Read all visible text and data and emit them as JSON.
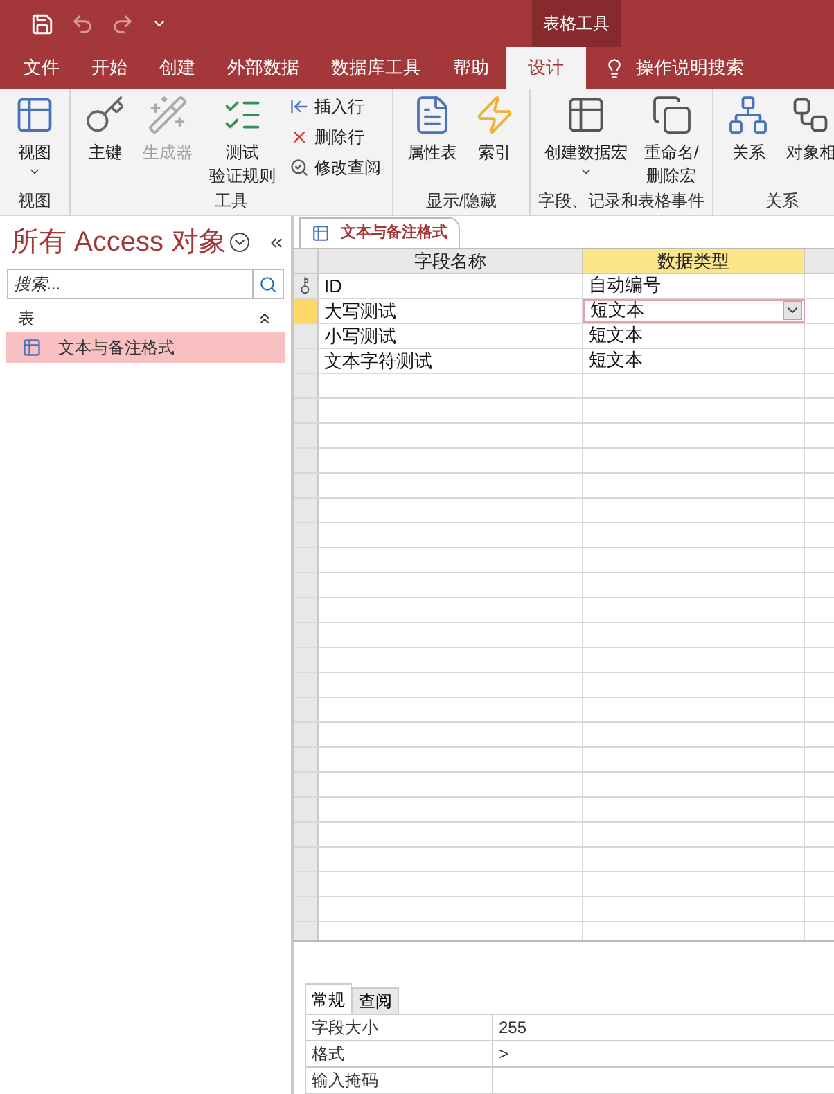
{
  "title_bar": {
    "contextual_label": "表格工具",
    "quick_access": [
      {
        "kind": "save",
        "disabled": false
      },
      {
        "kind": "undo",
        "disabled": true
      },
      {
        "kind": "redo",
        "disabled": true
      },
      {
        "kind": "customize",
        "disabled": false
      }
    ]
  },
  "ribbon_tabs": [
    {
      "label": "文件",
      "selected": false
    },
    {
      "label": "开始",
      "selected": false
    },
    {
      "label": "创建",
      "selected": false
    },
    {
      "label": "外部数据",
      "selected": false
    },
    {
      "label": "数据库工具",
      "selected": false
    },
    {
      "label": "帮助",
      "selected": false
    },
    {
      "label": "设计",
      "selected": true
    }
  ],
  "tell_me": "操作说明搜索",
  "ribbon_groups": [
    {
      "label": "视图",
      "items": [
        {
          "kind": "large",
          "label_lines": [
            "视图"
          ],
          "dropdown": true,
          "disabled": false
        }
      ]
    },
    {
      "label": "工具",
      "items": [
        {
          "kind": "large",
          "label_lines": [
            "主键"
          ],
          "dropdown": false,
          "disabled": false
        },
        {
          "kind": "large",
          "label_lines": [
            "生成器"
          ],
          "dropdown": false,
          "disabled": true
        },
        {
          "kind": "large",
          "label_lines": [
            "测试",
            "验证规则"
          ],
          "dropdown": false,
          "disabled": false
        },
        {
          "kind": "small",
          "label_lines": [
            "插入行"
          ],
          "disabled": false
        },
        {
          "kind": "small",
          "label_lines": [
            "删除行"
          ],
          "disabled": false
        },
        {
          "kind": "small",
          "label_lines": [
            "修改查阅"
          ],
          "disabled": false
        }
      ]
    },
    {
      "label": "显示/隐藏",
      "items": [
        {
          "kind": "large",
          "label_lines": [
            "属性表"
          ],
          "dropdown": false,
          "disabled": false
        },
        {
          "kind": "large",
          "label_lines": [
            "索引"
          ],
          "dropdown": false,
          "disabled": false
        }
      ]
    },
    {
      "label": "字段、记录和表格事件",
      "items": [
        {
          "kind": "large",
          "label_lines": [
            "创建数据宏"
          ],
          "dropdown": true,
          "disabled": false
        },
        {
          "kind": "large",
          "label_lines": [
            "重命名/",
            "删除宏"
          ],
          "dropdown": false,
          "disabled": false
        }
      ]
    },
    {
      "label": "关系",
      "items": [
        {
          "kind": "large",
          "label_lines": [
            "关系"
          ],
          "dropdown": false,
          "disabled": false
        },
        {
          "kind": "large",
          "label_lines": [
            "对象相"
          ],
          "dropdown": false,
          "disabled": false
        }
      ]
    }
  ],
  "navigation_pane": {
    "title": "所有 Access 对象",
    "search": {
      "placeholder": "搜索..."
    },
    "section": {
      "label": "表",
      "expanded": true,
      "items": [
        {
          "label": "文本与备注格式",
          "selected": true
        }
      ]
    }
  },
  "document_tab": {
    "label": "文本与备注格式"
  },
  "design_grid": {
    "columns": [
      {
        "label": "字段名称",
        "selected": false
      },
      {
        "label": "数据类型",
        "selected": true
      }
    ],
    "rows": [
      {
        "field_name": "ID",
        "data_type": "自动编号",
        "primary_key": true,
        "selected": false
      },
      {
        "field_name": "大写测试",
        "data_type": "短文本",
        "primary_key": false,
        "selected": true
      },
      {
        "field_name": "小写测试",
        "data_type": "短文本",
        "primary_key": false,
        "selected": false
      },
      {
        "field_name": "文本字符测试",
        "data_type": "短文本",
        "primary_key": false,
        "selected": false
      }
    ]
  },
  "field_properties": {
    "tabs": [
      {
        "label": "常规",
        "selected": true
      },
      {
        "label": "查阅",
        "selected": false
      }
    ],
    "rows": [
      {
        "label": "字段大小",
        "value": "255"
      },
      {
        "label": "格式",
        "value": ">"
      },
      {
        "label": "输入掩码"
      }
    ]
  }
}
